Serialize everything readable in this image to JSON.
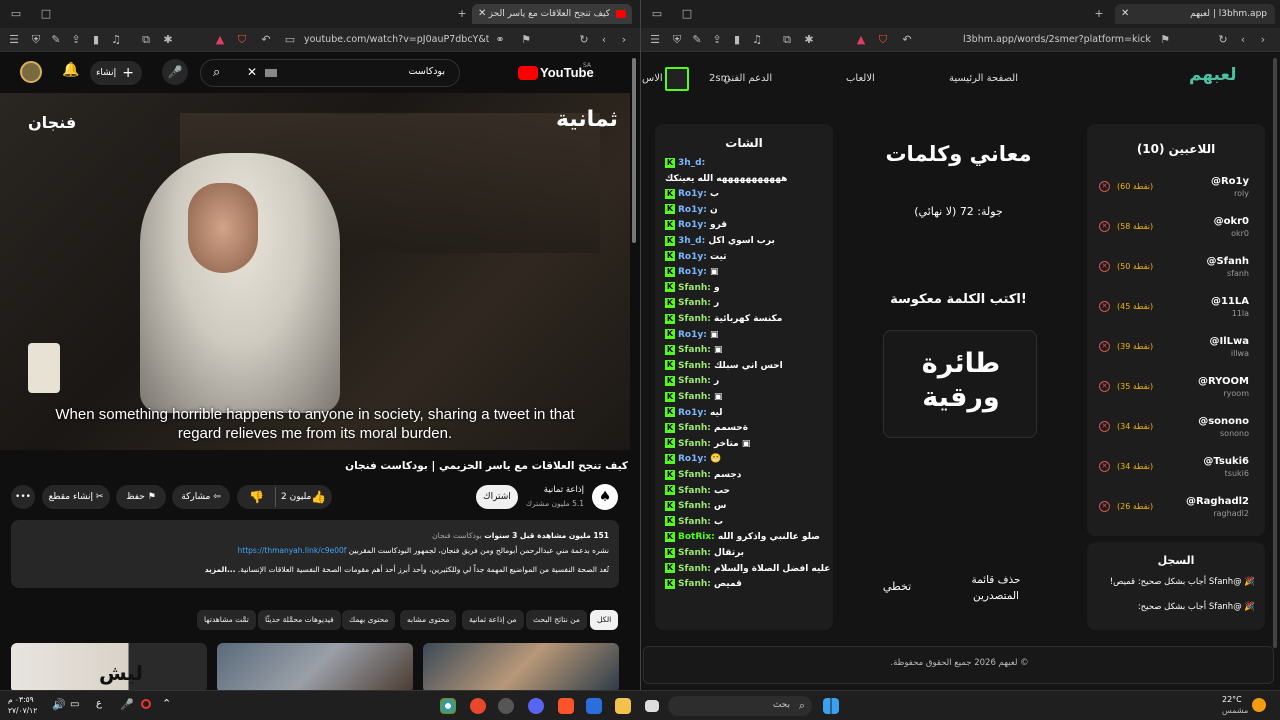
{
  "left_browser": {
    "tab_title": "كيف تنجح العلاقات مع ياسر الحز",
    "url": "youtube.com/watch?v=pJ0auP7dbcY&t=4...",
    "youtube": {
      "logo": "YouTube",
      "logo_region": "SA",
      "search_value": "بودكاست",
      "create_label": "إنشاء",
      "video_brand_right": "ثمانية",
      "video_brand_left": "فنجان",
      "caption_line1": "When something horrible happens to anyone in society, sharing a tweet in that",
      "caption_line2": "regard relieves me from its moral burden.",
      "video_title": "كيف تنجح العلاقات مع ياسر الحزيمي | بودكاست فنجان",
      "channel_name": "إذاعة ثمانية",
      "channel_subs": "5.1 مليون مشترك",
      "subscribe_label": "اشتراك",
      "like_count": "2 مليون",
      "share_label": "مشاركة",
      "save_label": "حفظ",
      "clip_label": "إنشاء مقطع",
      "desc_stats": "151 مليون مشاهدة قبل 3 سنوات",
      "desc_tag": "بودكاست فنجان",
      "desc_line2_text": "نشره بدعمة مني عبدالرحمن أبومالح ومن فريق فنجان، لجمهور البودكاست المقربين",
      "desc_link": "https://thmanyah.link/c9e00f",
      "desc_line3": "تُعد الصحة النفسية من المواضيع المهمة جداً لي وللكثيرين، وأحد أبرز أحد أهم مقومات الصحة النفسية العلاقات الإنسانية.",
      "desc_more": "...المزيد",
      "chips": [
        "الكل",
        "من نتائج البحث",
        "من إذاعة ثمانية",
        "محتوى مشابه",
        "محتوى بهمك",
        "فيديوهات محمَّلة حديثًا",
        "تمَّت مشاهدتها"
      ],
      "thumb_text": "ليش"
    }
  },
  "right_browser": {
    "tab_title": "لعبهم | l3bhm.app",
    "url": "l3bhm.app/words/2smer?platform=kick",
    "app": {
      "logo": "لعبهم",
      "nav": [
        "الصفحة الرئيسية",
        "الالعاب",
        "الدعم الفني",
        "الاس"
      ],
      "nav_user_fragment": "2sm",
      "players_title": "اللاعبين (10)",
      "players": [
        {
          "name": "@Ro1y",
          "user": "roly",
          "points": "(60 نقطة)"
        },
        {
          "name": "@okr0",
          "user": "okr0",
          "points": "(58 نقطة)"
        },
        {
          "name": "@Sfanh",
          "user": "sfanh",
          "points": "(50 نقطة)"
        },
        {
          "name": "@11LA",
          "user": "11la",
          "points": "(45 نقطة)"
        },
        {
          "name": "@IlLwa",
          "user": "illwa",
          "points": "(39 نقطة)"
        },
        {
          "name": "@RYOOM",
          "user": "ryoom",
          "points": "(35 نقطة)"
        },
        {
          "name": "@sonono",
          "user": "sonono",
          "points": "(34 نقطة)"
        },
        {
          "name": "@Tsuki6",
          "user": "tsuki6",
          "points": "(34 نقطة)"
        },
        {
          "name": "@Raghadl2",
          "user": "raghadl2",
          "points": "(26 نقطة)"
        }
      ],
      "log_title": "السجل",
      "log_entries": [
        "🎉 @Sfanh أجاب بشكل صحيح: قميص!",
        "🎉 @Sfanh أجاب بشكل صحيح:"
      ],
      "game_title": "معاني وكلمات",
      "round": "جولة: 72 (لا نهائي)",
      "instruction": "اكتب الكلمة معكوسة!",
      "word": "طائرة ورقية",
      "delete_board": "حذف قائمة المتصدرين",
      "skip": "تخطي",
      "chat_title": "الشات",
      "chat": [
        {
          "u": "3h_d:",
          "m": ""
        },
        {
          "u": "",
          "m": "هههههههههههه الله يعينكك"
        },
        {
          "u": "Ro1y:",
          "m": "ب"
        },
        {
          "u": "Ro1y:",
          "m": "ن"
        },
        {
          "u": "Ro1y:",
          "m": "قرو"
        },
        {
          "u": "3h_d:",
          "m": "برب اسوي اكل"
        },
        {
          "u": "Ro1y:",
          "m": "تيت"
        },
        {
          "u": "Ro1y:",
          "m": "▣"
        },
        {
          "u": "Sfanh:",
          "m": "و"
        },
        {
          "u": "Sfanh:",
          "m": "ر"
        },
        {
          "u": "Sfanh:",
          "m": "مكنسة كهربائية"
        },
        {
          "u": "Ro1y:",
          "m": "▣"
        },
        {
          "u": "Sfanh:",
          "m": "▣"
        },
        {
          "u": "Sfanh:",
          "m": "احس اني سبلك"
        },
        {
          "u": "Sfanh:",
          "m": "ر"
        },
        {
          "u": "Sfanh:",
          "m": "▣"
        },
        {
          "u": "Ro1y:",
          "m": "ليه"
        },
        {
          "u": "Sfanh:",
          "m": "ةحسمم"
        },
        {
          "u": "Sfanh:",
          "m": "متاخر ▣"
        },
        {
          "u": "Ro1y:",
          "m": "😬"
        },
        {
          "u": "Sfanh:",
          "m": "دجسم"
        },
        {
          "u": "Sfanh:",
          "m": "حب"
        },
        {
          "u": "Sfanh:",
          "m": "س"
        },
        {
          "u": "Sfanh:",
          "m": "ب"
        },
        {
          "u": "BotRix:",
          "m": "صلو عالنبي واذكرو الله"
        },
        {
          "u": "Sfanh:",
          "m": "برتقال"
        },
        {
          "u": "Sfanh:",
          "m": "عليه افضل الصلاة والسلام"
        },
        {
          "u": "Sfanh:",
          "m": "قميص"
        }
      ],
      "footer": "© لعبهم 2026 جميع الحقوق محفوظة."
    }
  },
  "taskbar": {
    "time": "٠٣:٥٩ م",
    "date": "٢٧/٠٧/١٢",
    "lang": "ع",
    "search_placeholder": "بحث",
    "weather_temp": "22°C",
    "weather_desc": "مشمس"
  },
  "colors": {
    "kick_green": "#53fc18",
    "yt_red": "#ff0000",
    "points_gold": "#f0b400",
    "kick_red": "#e05050"
  }
}
